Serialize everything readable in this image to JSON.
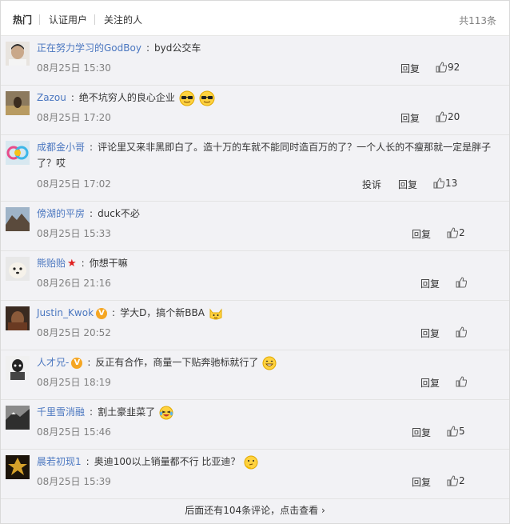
{
  "tabs": [
    "热门",
    "认证用户",
    "关注的人"
  ],
  "total": "共113条",
  "comments": [
    {
      "user": "正在努力学习的GodBoy",
      "text": "byd公交车",
      "date": "08月25日 15:30",
      "reply": "回复",
      "likes": "92",
      "report": ""
    },
    {
      "user": "Zazou",
      "text": "绝不坑穷人的良心企业",
      "date": "08月25日 17:20",
      "reply": "回复",
      "likes": "20",
      "report": ""
    },
    {
      "user": "成都金小哥",
      "text": "评论里又来非黑即白了。造十万的车就不能同时造百万的了？一个人长的不瘦那就一定是胖子了？哎",
      "date": "08月25日 17:02",
      "reply": "回复",
      "likes": "13",
      "report": "投诉"
    },
    {
      "user": "傍湖的平房",
      "text": "duck不必",
      "date": "08月25日 15:33",
      "reply": "回复",
      "likes": "2",
      "report": ""
    },
    {
      "user": "熊贻贻",
      "text": "你想干嘛",
      "date": "08月26日 21:16",
      "reply": "回复",
      "likes": "",
      "report": ""
    },
    {
      "user": "Justin_Kwok",
      "text": "学大D，搞个新BBA",
      "date": "08月25日 20:52",
      "reply": "回复",
      "likes": "",
      "report": ""
    },
    {
      "user": "人才兄-",
      "text": "反正有合作，商量一下贴奔驰标就行了",
      "date": "08月25日 18:19",
      "reply": "回复",
      "likes": "",
      "report": ""
    },
    {
      "user": "千里雪消融",
      "text": "割土豪韭菜了",
      "date": "08月25日 15:46",
      "reply": "回复",
      "likes": "5",
      "report": ""
    },
    {
      "user": "晨若初现1",
      "text": "奥迪100以上销量都不行 比亚迪？",
      "date": "08月25日 15:39",
      "reply": "回复",
      "likes": "2",
      "report": ""
    }
  ],
  "more": "后面还有104条评论，点击查看 ›",
  "icons": {
    "like": "thumbs-up-icon",
    "verified": "verified-badge-icon",
    "star": "red-star-badge-icon"
  }
}
